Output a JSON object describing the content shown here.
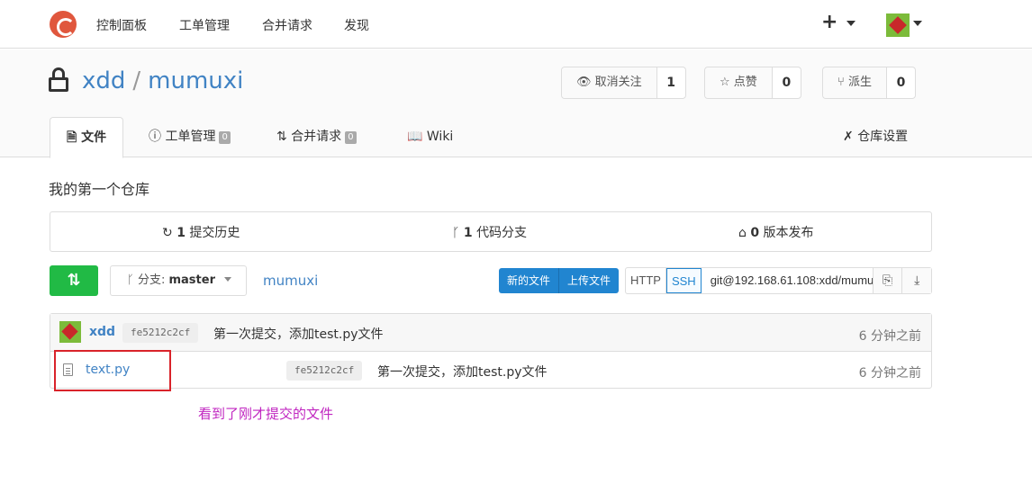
{
  "topnav": {
    "items": [
      "控制面板",
      "工单管理",
      "合并请求",
      "发现"
    ],
    "plus": "+"
  },
  "repo": {
    "owner": "xdd",
    "separator": "/",
    "name": "mumuxi",
    "watch": {
      "label": "取消关注",
      "count": "1"
    },
    "star": {
      "label": "点赞",
      "count": "0"
    },
    "fork": {
      "label": "派生",
      "count": "0"
    }
  },
  "tabs": {
    "files": "文件",
    "issues": "工单管理",
    "issues_count": "0",
    "pulls": "合并请求",
    "pulls_count": "0",
    "wiki": "Wiki",
    "settings": "仓库设置"
  },
  "description": "我的第一个仓库",
  "stats": {
    "commits_count": "1",
    "commits_label": "提交历史",
    "branches_count": "1",
    "branches_label": "代码分支",
    "releases_count": "0",
    "releases_label": "版本发布"
  },
  "toolbar": {
    "branch_prefix": "分支:",
    "branch": "master",
    "path": "mumuxi",
    "new_file": "新的文件",
    "upload_file": "上传文件",
    "http": "HTTP",
    "ssh": "SSH",
    "clone_url": "git@192.168.61.108:xdd/mumuxi.git"
  },
  "latest_commit": {
    "author": "xdd",
    "sha": "fe5212c2cf",
    "message": "第一次提交，添加test.py文件",
    "time": "6 分钟之前"
  },
  "files": [
    {
      "name": "text.py",
      "sha": "fe5212c2cf",
      "message": "第一次提交，添加test.py文件",
      "time": "6 分钟之前"
    }
  ],
  "annotation": "看到了刚才提交的文件",
  "colors": {
    "link": "#4183c4",
    "green": "#21ba45",
    "blue": "#2185d0",
    "annotation": "#c026c0",
    "highlight_box": "#d9232a"
  }
}
